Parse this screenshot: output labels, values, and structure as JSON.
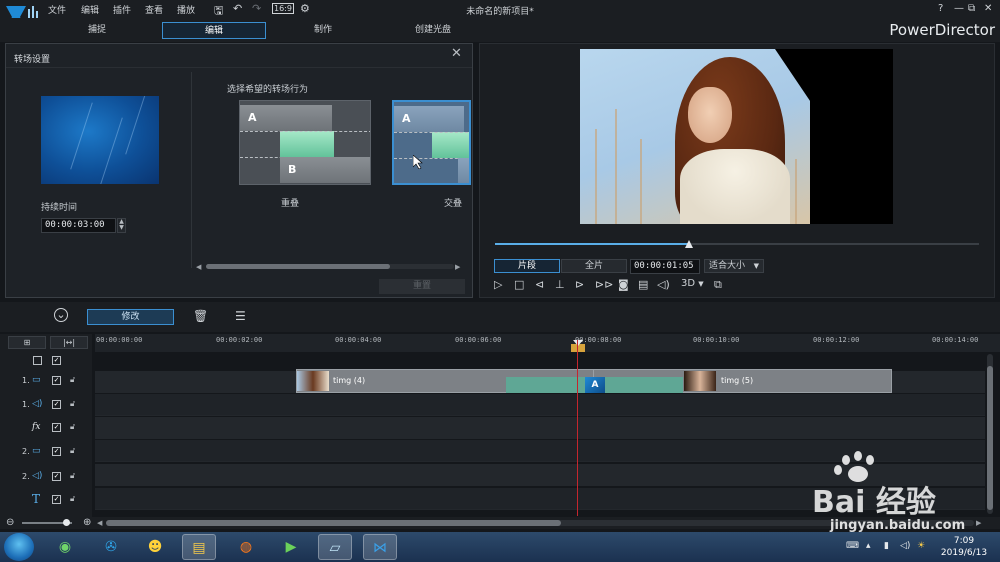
{
  "menu": {
    "items": [
      "文件",
      "编辑",
      "插件",
      "查看",
      "播放"
    ],
    "window_title": "未命名的新项目*"
  },
  "modes": {
    "tabs": [
      "捕捉",
      "编辑",
      "制作",
      "创建光盘"
    ],
    "active_index": 1,
    "brand": "PowerDirector"
  },
  "transition_panel": {
    "title": "转场设置",
    "duration_label": "持续时间",
    "duration_value": "00:00:03:00",
    "choose_label": "选择希望的转场行为",
    "options": [
      {
        "label": "重叠",
        "blocks": [
          "A",
          "B"
        ],
        "selected": false
      },
      {
        "label": "交叠",
        "blocks": [
          "A"
        ],
        "selected": true
      }
    ],
    "apply_label": "重置"
  },
  "preview": {
    "tabs": [
      "片段",
      "全片"
    ],
    "active_tab": 0,
    "timecode": "00:00:01:05",
    "fit_label": "适合大小",
    "mode_3d": "3D",
    "progress": 0.4
  },
  "timeline_toolbar": {
    "modify_label": "修改"
  },
  "ruler": {
    "ticks": [
      "00:00:00:00",
      "00:00:02:00",
      "00:00:04:00",
      "00:00:06:00",
      "00:00:08:00",
      "00:00:10:00",
      "00:00:12:00",
      "00:00:14:00"
    ]
  },
  "tracks": [
    {
      "label": "1.",
      "type": "video"
    },
    {
      "label": "1.",
      "type": "audio"
    },
    {
      "label": "",
      "type": "fx",
      "glyph": "fx"
    },
    {
      "label": "2.",
      "type": "video"
    },
    {
      "label": "2.",
      "type": "audio"
    },
    {
      "label": "",
      "type": "title",
      "glyph": "T"
    }
  ],
  "clips": [
    {
      "name": "timg (4)"
    },
    {
      "name": "timg (5)"
    }
  ],
  "taskbar": {
    "time": "7:09",
    "date": "2019/6/13"
  },
  "watermark": {
    "text": "Bai 经验",
    "url": "jingyan.baidu.com"
  }
}
